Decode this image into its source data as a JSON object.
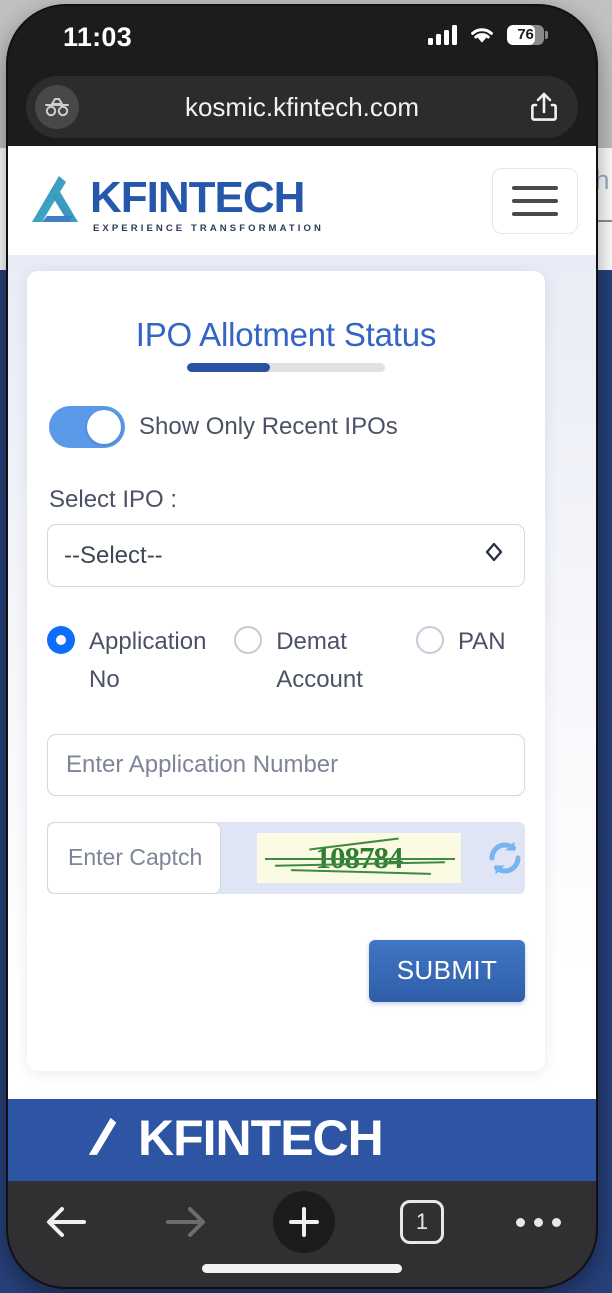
{
  "status_bar": {
    "time": "11:03",
    "signal_icon": "cellular-signal-icon",
    "wifi_icon": "wifi-icon",
    "battery_percent": "76",
    "battery_level": 76
  },
  "browser": {
    "url": "kosmic.kfintech.com",
    "private_icon": "private-browsing-icon",
    "share_icon": "share-icon",
    "toolbar": {
      "back_icon": "back-arrow-icon",
      "forward_icon": "forward-arrow-icon",
      "new_tab_icon": "plus-icon",
      "tab_count": "1",
      "more_icon": "more-dots-icon"
    }
  },
  "site_header": {
    "logo_text": "KFINTECH",
    "logo_tagline": "EXPERIENCE TRANSFORMATION",
    "logo_mark_icon": "kfintech-triangle-logo-icon",
    "menu_icon": "hamburger-menu-icon"
  },
  "card": {
    "title": "IPO Allotment Status",
    "toggle": {
      "label": "Show Only Recent IPOs",
      "state": "on"
    },
    "select_ipo": {
      "label": "Select IPO :",
      "value": "--Select--",
      "chevron_icon": "chevron-updown-icon"
    },
    "search_type": {
      "options": [
        {
          "label": "Application No",
          "selected": true
        },
        {
          "label": "Demat Account",
          "selected": false
        },
        {
          "label": "PAN",
          "selected": false
        }
      ]
    },
    "application_input": {
      "placeholder": "Enter Application Number",
      "value": ""
    },
    "captcha": {
      "input_placeholder": "Enter Captch",
      "value": "",
      "code": "108784",
      "refresh_icon": "refresh-icon"
    },
    "submit_label": "SUBMIT"
  },
  "site_footer": {
    "logo_text": "KFINTECH",
    "logo_mark_icon": "kfintech-triangle-logo-icon"
  },
  "backdrop": {
    "partial_text": "sh"
  },
  "colors": {
    "brand_blue": "#2557ab",
    "title_blue": "#3465c4",
    "accent_bar": "#2b52a0",
    "toggle_on": "#5b9ae8",
    "radio_selected": "#0d6efd",
    "captcha_green": "#2e7d32",
    "captcha_bg": "#fbfbe3",
    "footer_blue": "#2d55a4",
    "page_bg": "#eef0f8"
  }
}
